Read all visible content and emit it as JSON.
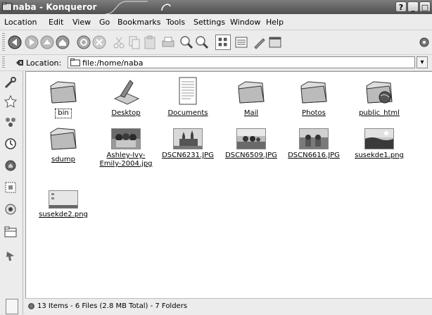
{
  "window": {
    "title": "naba - Konqueror"
  },
  "menu": [
    "Location",
    "Edit",
    "View",
    "Go",
    "Bookmarks",
    "Tools",
    "Settings",
    "Window",
    "Help"
  ],
  "location": {
    "label": "Location:",
    "value": "file:/home/naba"
  },
  "files": [
    {
      "name": "bin",
      "type": "folder"
    },
    {
      "name": "Desktop",
      "type": "desktop"
    },
    {
      "name": "Documents",
      "type": "document"
    },
    {
      "name": "Mail",
      "type": "folder"
    },
    {
      "name": "Photos",
      "type": "folder"
    },
    {
      "name": "public_html",
      "type": "web-folder"
    },
    {
      "name": "sdump",
      "type": "folder"
    },
    {
      "name": "Ashley-Ivy-Emily-2004.jpg",
      "name_line1": "Ashley-Ivy-",
      "name_line2": "Emily-2004.jpg",
      "type": "image"
    },
    {
      "name": "DSCN6231.JPG",
      "type": "image"
    },
    {
      "name": "DSCN6509.JPG",
      "type": "image"
    },
    {
      "name": "DSCN6616.JPG",
      "type": "image"
    },
    {
      "name": "susekde1.png",
      "type": "image"
    },
    {
      "name": "susekde2.png",
      "type": "image"
    }
  ],
  "status": {
    "text": "13 Items - 6 Files (2.8 MB Total) - 7 Folders"
  }
}
